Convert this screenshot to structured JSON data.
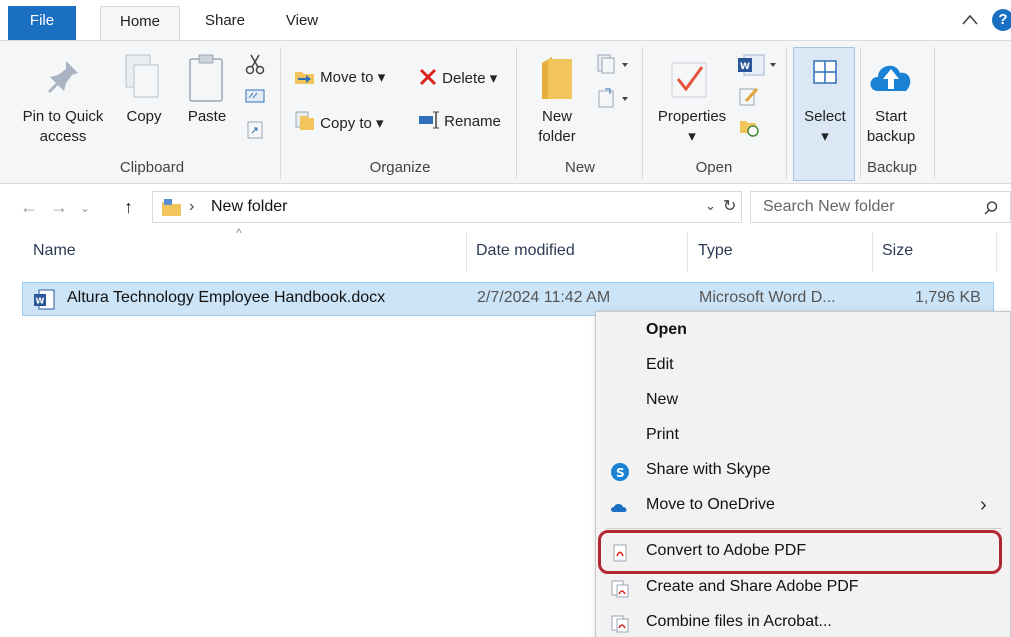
{
  "tabs": {
    "file": "File",
    "home": "Home",
    "share": "Share",
    "view": "View"
  },
  "help_label": "?",
  "ribbon": {
    "clipboard": {
      "label": "Clipboard",
      "pin_line1": "Pin to Quick",
      "pin_line2": "access",
      "copy": "Copy",
      "paste": "Paste"
    },
    "organize": {
      "label": "Organize",
      "move_to": "Move to",
      "copy_to": "Copy to",
      "delete": "Delete",
      "rename": "Rename"
    },
    "new": {
      "label": "New",
      "new_folder_line1": "New",
      "new_folder_line2": "folder"
    },
    "open": {
      "label": "Open",
      "properties": "Properties"
    },
    "select": {
      "label": "Select"
    },
    "backup": {
      "label": "Backup",
      "start_line1": "Start",
      "start_line2": "backup"
    }
  },
  "address": {
    "path": "New folder",
    "search_placeholder": "Search New folder"
  },
  "columns": {
    "name": "Name",
    "date": "Date modified",
    "type": "Type",
    "size": "Size"
  },
  "file": {
    "name": "Altura Technology Employee Handbook.docx",
    "date": "2/7/2024 11:42 AM",
    "type": "Microsoft Word D...",
    "size": "1,796 KB"
  },
  "context_menu": {
    "items": [
      {
        "label": "Open"
      },
      {
        "label": "Edit"
      },
      {
        "label": "New"
      },
      {
        "label": "Print"
      },
      {
        "label": "Share with Skype"
      },
      {
        "label": "Move to OneDrive"
      },
      {
        "label": "Convert to Adobe PDF"
      },
      {
        "label": "Create and Share Adobe PDF"
      },
      {
        "label": "Combine files in Acrobat..."
      }
    ]
  },
  "colors": {
    "accent": "#1a6fc2",
    "selection": "#cce4f7",
    "highlight_border": "#b1272d",
    "folder": "#f2c55c"
  }
}
